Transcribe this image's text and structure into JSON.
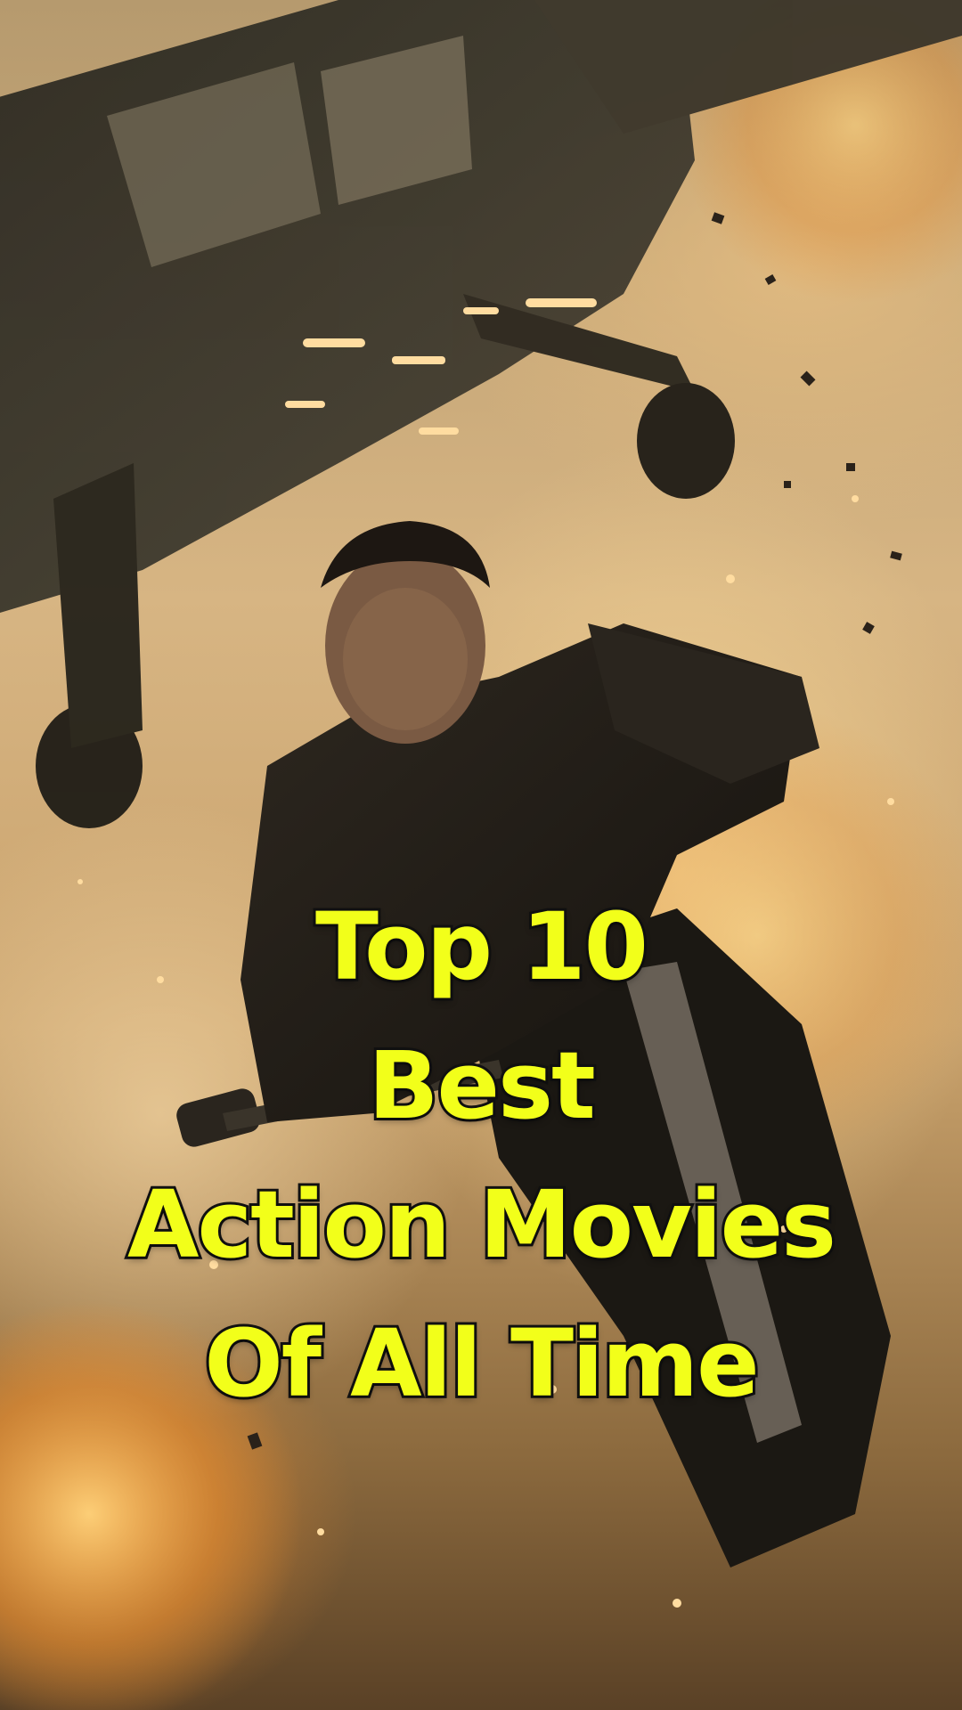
{
  "title": {
    "line1": "Top 10",
    "line2": "Best",
    "line3": "Action Movies",
    "line4": "Of All Time"
  },
  "colors": {
    "title_fill": "#f2ff1a",
    "title_outline": "#111111"
  },
  "image": {
    "subject": "man riding motorcycle",
    "background": "helicopter and explosion"
  }
}
